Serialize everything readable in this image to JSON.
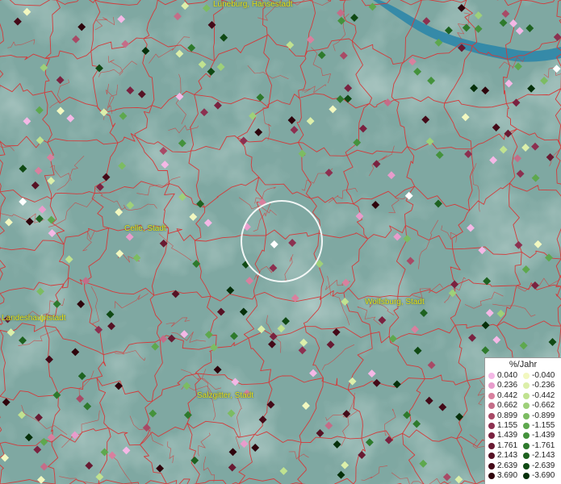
{
  "map": {
    "cities": [
      {
        "id": "lueneburg",
        "label": "Lüneburg, Hansestadt"
      },
      {
        "id": "celle",
        "label": "Celle, Stadt"
      },
      {
        "id": "hannover",
        "label": "Landeshauptstadt"
      },
      {
        "id": "wolfsburg",
        "label": "Wolfsburg, Stadt"
      },
      {
        "id": "salzgitter",
        "label": "Salzgitter, Stadt"
      }
    ],
    "colors": {
      "terrain": "#7fa8a2",
      "boundaries": "#d43a3a",
      "water": "#2e86a8",
      "selection_ring": "#ffffff"
    },
    "selection": "highlight-circle"
  },
  "legend": {
    "title": "%/Jahr",
    "positive": [
      {
        "value": "0.040",
        "color": "#f4b8e6"
      },
      {
        "value": "0.236",
        "color": "#e89ccc"
      },
      {
        "value": "0.442",
        "color": "#d8809e"
      },
      {
        "value": "0.662",
        "color": "#c46d88"
      },
      {
        "value": "0.899",
        "color": "#a84a66"
      },
      {
        "value": "1.155",
        "color": "#8c3050"
      },
      {
        "value": "1.439",
        "color": "#7a2240"
      },
      {
        "value": "1.761",
        "color": "#681a32"
      },
      {
        "value": "2.143",
        "color": "#561224"
      },
      {
        "value": "2.639",
        "color": "#440a18"
      },
      {
        "value": "3.690",
        "color": "#2e040c"
      }
    ],
    "negative": [
      {
        "value": "-0.040",
        "color": "#f2f8c0"
      },
      {
        "value": "-0.236",
        "color": "#dcefaa"
      },
      {
        "value": "-0.442",
        "color": "#c0e290"
      },
      {
        "value": "-0.662",
        "color": "#9ed07a"
      },
      {
        "value": "-0.899",
        "color": "#7cbc62"
      },
      {
        "value": "-1.155",
        "color": "#5ea84e"
      },
      {
        "value": "-1.439",
        "color": "#44923c"
      },
      {
        "value": "-1.761",
        "color": "#2e7a2c"
      },
      {
        "value": "-2.143",
        "color": "#1e6220"
      },
      {
        "value": "-2.639",
        "color": "#104a14"
      },
      {
        "value": "-3.690",
        "color": "#06300a"
      }
    ]
  }
}
